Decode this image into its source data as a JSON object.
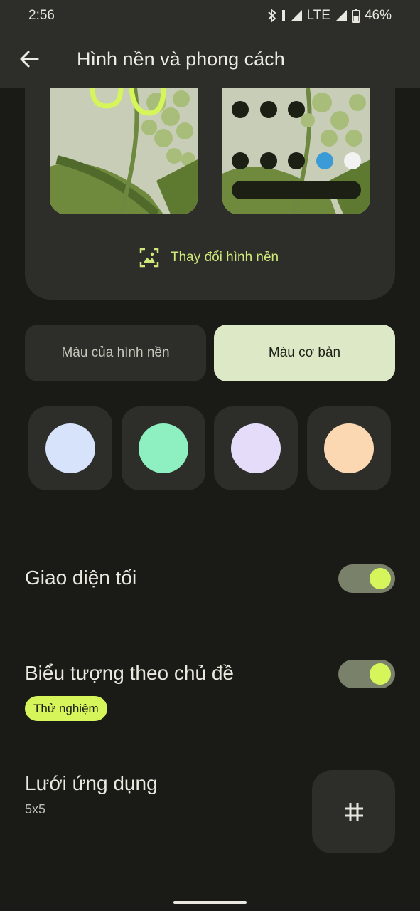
{
  "status_bar": {
    "time": "2:56",
    "network": "LTE",
    "battery": "46%"
  },
  "header": {
    "title": "Hình nền và phong cách"
  },
  "wallpaper": {
    "change_label": "Thay đổi hình nền"
  },
  "color_tabs": [
    {
      "label": "Màu của hình nền",
      "selected": false
    },
    {
      "label": "Màu cơ bản",
      "selected": true
    }
  ],
  "swatches": [
    "#d6e3fb",
    "#8ef0c0",
    "#e4dcf8",
    "#fcd8b2"
  ],
  "settings": {
    "dark_theme": {
      "label": "Giao diện tối",
      "on": true
    },
    "themed_icons": {
      "label": "Biểu tượng theo chủ đề",
      "badge": "Thử nghiệm",
      "on": true
    },
    "app_grid": {
      "label": "Lưới ứng dụng",
      "value": "5x5"
    }
  },
  "colors": {
    "accent": "#d5f55a",
    "background": "#1a1b16",
    "surface": "#2d2e29"
  }
}
